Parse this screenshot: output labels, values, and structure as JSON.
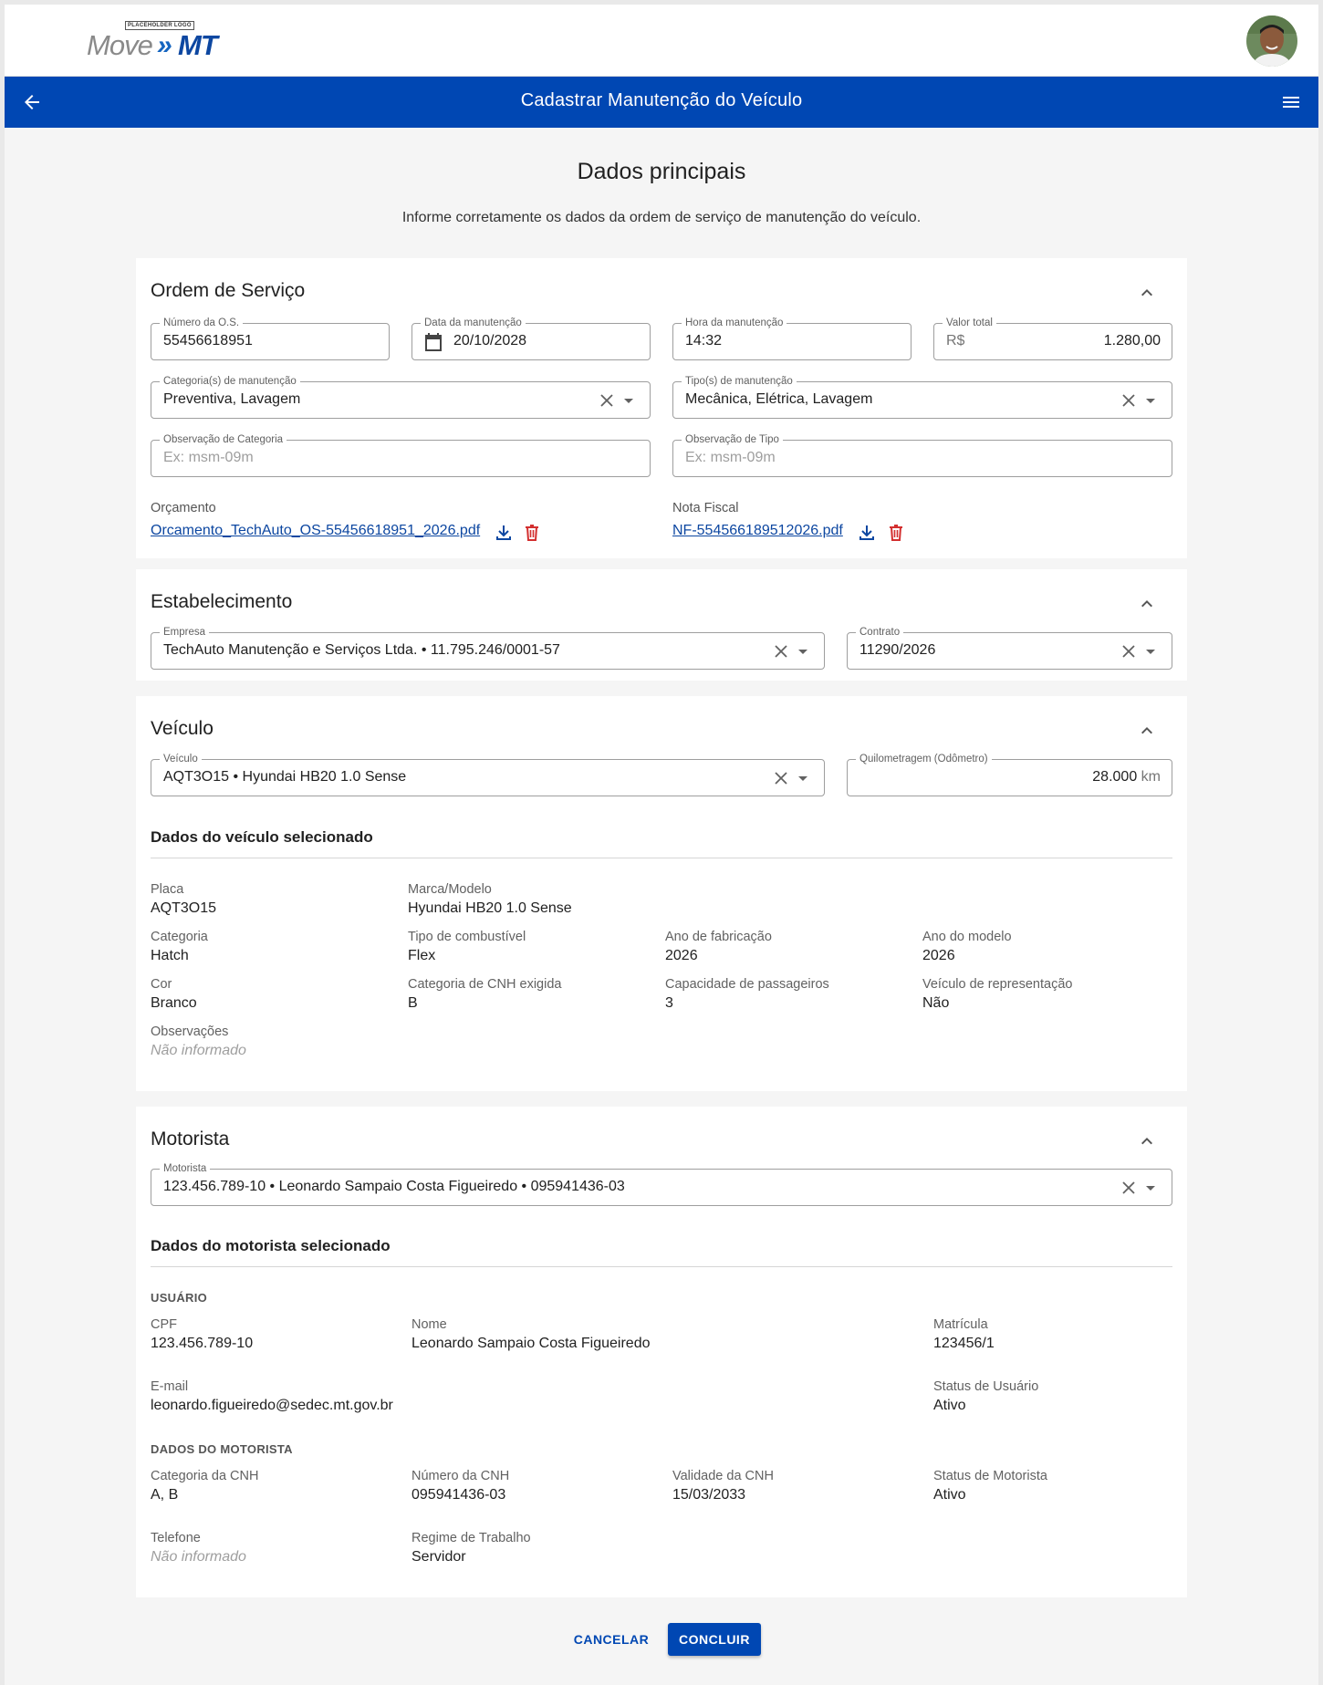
{
  "header": {
    "logo_tag": "PLACEHOLDER LOGO",
    "logo_move": "Move",
    "logo_chevron": "»",
    "logo_mt": "MT"
  },
  "appbar": {
    "title": "Cadastrar Manutenção do Veículo"
  },
  "page": {
    "title": "Dados principais",
    "subtitle": "Informe corretamente os dados da ordem de serviço de manutenção do veículo."
  },
  "ordem": {
    "title": "Ordem de Serviço",
    "numero_label": "Número da O.S.",
    "numero_value": "55456618951",
    "data_label": "Data da manutenção",
    "data_value": "20/10/2028",
    "hora_label": "Hora da manutenção",
    "hora_value": "14:32",
    "valor_label": "Valor total",
    "valor_prefix": "R$",
    "valor_value": "1.280,00",
    "categoria_label": "Categoria(s) de manutenção",
    "categoria_value": "Preventiva, Lavagem",
    "tipo_label": "Tipo(s) de manutenção",
    "tipo_value": "Mecânica, Elétrica, Lavagem",
    "obs_categoria_label": "Observação de Categoria",
    "obs_categoria_placeholder": "Ex: msm-09m",
    "obs_tipo_label": "Observação de Tipo",
    "obs_tipo_placeholder": "Ex: msm-09m",
    "orcamento_label": "Orçamento",
    "orcamento_file": "Orcamento_TechAuto_OS-55456618951_2026.pdf",
    "nota_label": "Nota Fiscal",
    "nota_file": "NF-554566189512026.pdf"
  },
  "estabelecimento": {
    "title": "Estabelecimento",
    "empresa_label": "Empresa",
    "empresa_value": "TechAuto Manutenção e Serviços Ltda. • 11.795.246/0001-57",
    "contrato_label": "Contrato",
    "contrato_value": "11290/2026"
  },
  "veiculo": {
    "title": "Veículo",
    "veiculo_label": "Veículo",
    "veiculo_value": "AQT3O15 • Hyundai HB20 1.0 Sense",
    "km_label": "Quilometragem (Odômetro)",
    "km_value": "28.000",
    "km_suffix": "km",
    "details_title": "Dados do veículo selecionado",
    "placa_label": "Placa",
    "placa_value": "AQT3O15",
    "marca_label": "Marca/Modelo",
    "marca_value": "Hyundai HB20 1.0 Sense",
    "categoria_label": "Categoria",
    "categoria_value": "Hatch",
    "combustivel_label": "Tipo de combustível",
    "combustivel_value": "Flex",
    "ano_fab_label": "Ano de fabricação",
    "ano_fab_value": "2026",
    "ano_mod_label": "Ano do modelo",
    "ano_mod_value": "2026",
    "cor_label": "Cor",
    "cor_value": "Branco",
    "cnh_label": "Categoria de CNH exigida",
    "cnh_value": "B",
    "capacidade_label": "Capacidade de passageiros",
    "capacidade_value": "3",
    "representacao_label": "Veículo de representação",
    "representacao_value": "Não",
    "obs_label": "Observações",
    "obs_value": "Não informado"
  },
  "motorista": {
    "title": "Motorista",
    "motorista_label": "Motorista",
    "motorista_value": "123.456.789-10 • Leonardo Sampaio Costa Figueiredo  • 095941436-03",
    "details_title": "Dados do motorista selecionado",
    "usuario_group": "USUÁRIO",
    "cpf_label": "CPF",
    "cpf_value": "123.456.789-10",
    "nome_label": "Nome",
    "nome_value": "Leonardo Sampaio Costa Figueiredo",
    "matricula_label": "Matrícula",
    "matricula_value": "123456/1",
    "email_label": "E-mail",
    "email_value": "leonardo.figueiredo@sedec.mt.gov.br",
    "status_usuario_label": "Status de Usuário",
    "status_usuario_value": "Ativo",
    "motorista_group": "DADOS DO MOTORISTA",
    "cat_cnh_label": "Categoria da CNH",
    "cat_cnh_value": "A, B",
    "num_cnh_label": "Número da CNH",
    "num_cnh_value": "095941436-03",
    "val_cnh_label": "Validade da CNH",
    "val_cnh_value": "15/03/2033",
    "status_motorista_label": "Status de Motorista",
    "status_motorista_value": "Ativo",
    "telefone_label": "Telefone",
    "telefone_value": "Não informado",
    "regime_label": "Regime de Trabalho",
    "regime_value": "Servidor"
  },
  "actions": {
    "cancel": "CANCELAR",
    "confirm": "CONCLUIR"
  },
  "colors": {
    "primary": "#0047b3",
    "link": "#0d47a1",
    "danger": "#d32f2f"
  },
  "icons": [
    "arrow-back-icon",
    "menu-icon",
    "chevron-up-icon",
    "calendar-icon",
    "close-icon",
    "dropdown-arrow-icon",
    "download-icon",
    "trash-icon"
  ]
}
